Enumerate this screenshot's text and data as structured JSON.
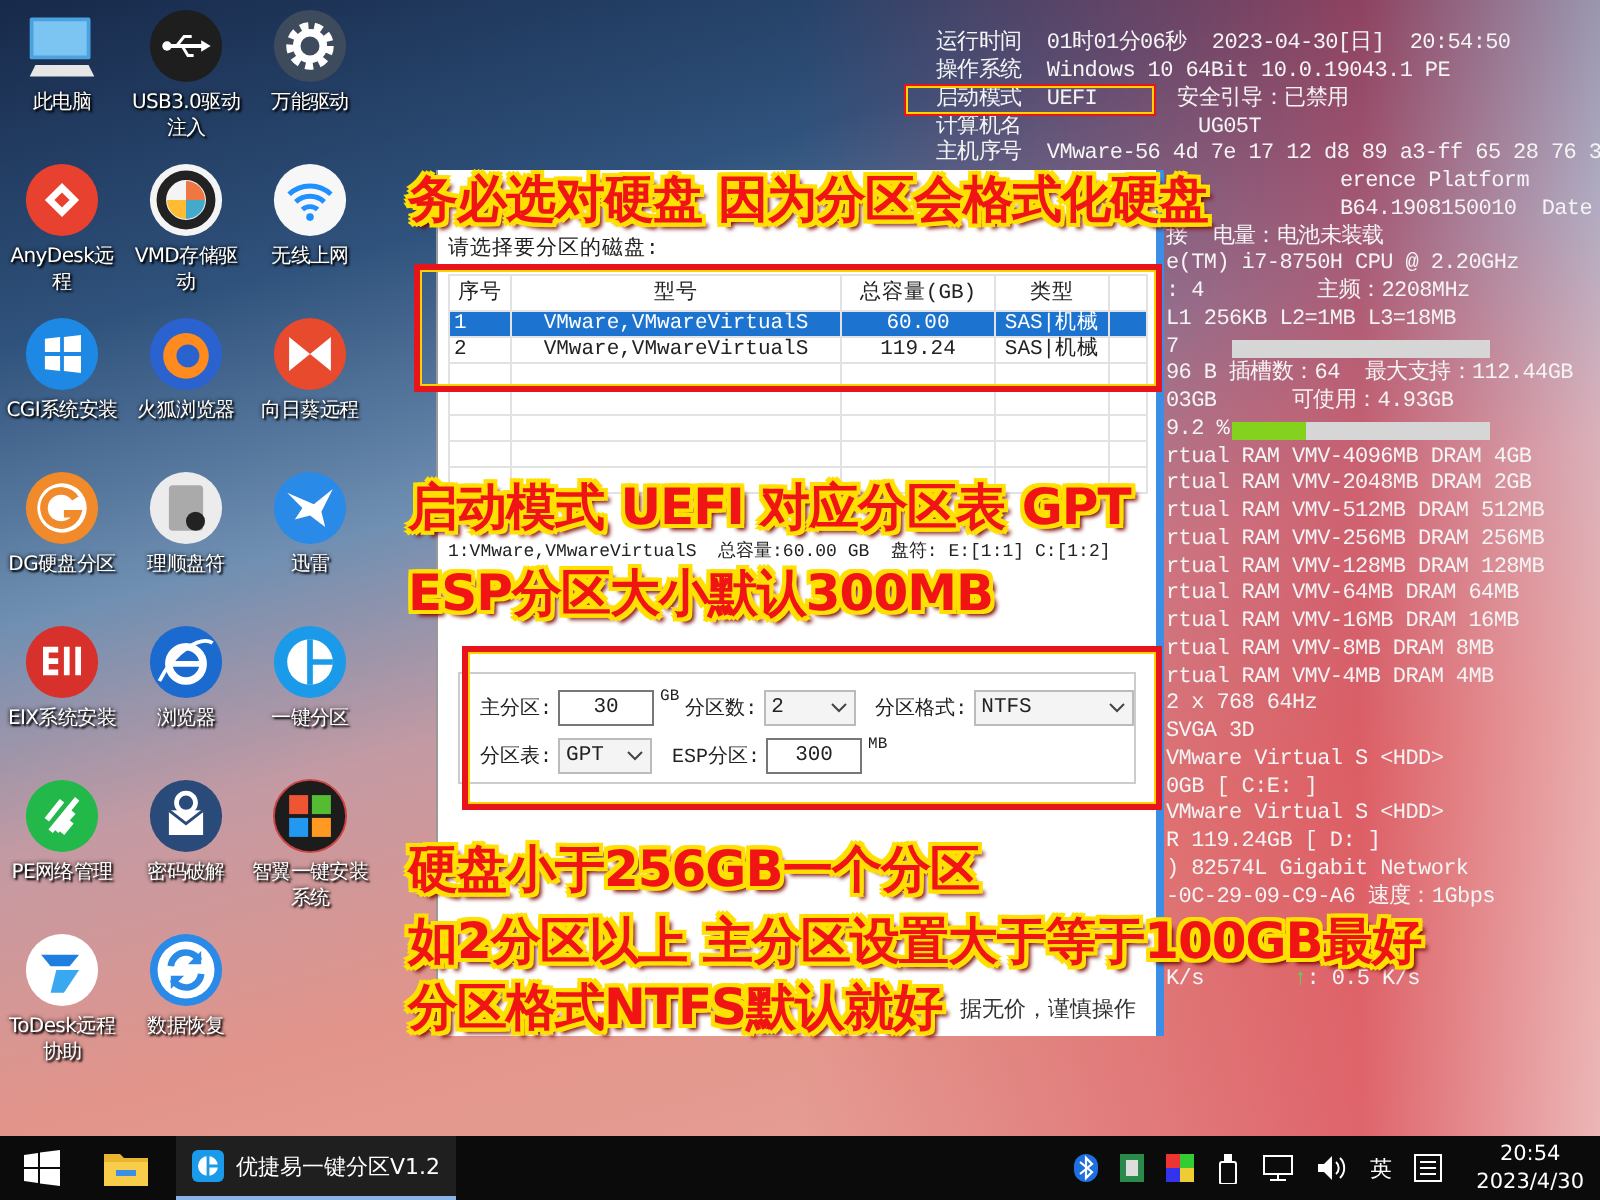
{
  "desktop_icons": [
    {
      "label": "此电脑",
      "kind": "monitor",
      "color": "#4aa3e0"
    },
    {
      "label": "USB3.0驱动注入",
      "kind": "usb",
      "color": "#1e1e1e"
    },
    {
      "label": "万能驱动",
      "kind": "gear",
      "color": "#3e4b5c"
    },
    {
      "label": "AnyDesk远程",
      "kind": "diamond",
      "color": "#e8412f"
    },
    {
      "label": "VMD存储驱动",
      "kind": "color-ring",
      "color": "#f4f4f4"
    },
    {
      "label": "无线上网",
      "kind": "wifi",
      "color": "#f7f7f7"
    },
    {
      "label": "CGI系统安装",
      "kind": "four-panes",
      "color": "#1e88e5"
    },
    {
      "label": "火狐浏览器",
      "kind": "flame",
      "color": "#2a62d0"
    },
    {
      "label": "向日葵远程",
      "kind": "bowtie",
      "color": "#e84a2e"
    },
    {
      "label": "DG硬盘分区",
      "kind": "arc",
      "color": "#f08a2a"
    },
    {
      "label": "理顺盘符",
      "kind": "disk",
      "color": "#ececec"
    },
    {
      "label": "迅雷",
      "kind": "bird",
      "color": "#2a8ae8"
    },
    {
      "label": "EIX系统安装",
      "kind": "bars",
      "color": "#d8302a"
    },
    {
      "label": "浏览器",
      "kind": "swoosh",
      "color": "#1a6ad0"
    },
    {
      "label": "一键分区",
      "kind": "pie",
      "color": "#1a9ae8"
    },
    {
      "label": "PE网络管理",
      "kind": "stripes",
      "color": "#22b84a"
    },
    {
      "label": "密码破解",
      "kind": "envelope",
      "color": "#2a4a7a"
    },
    {
      "label": "智翼一键安装系统",
      "kind": "tiles",
      "color": "#1c1c1c"
    },
    {
      "label": "ToDesk远程协助",
      "kind": "arrows",
      "color": "#ffffff"
    },
    {
      "label": "数据恢复",
      "kind": "sync",
      "color": "#2a8ae8"
    }
  ],
  "system_info": [
    {
      "kind": "full",
      "text": "运行时间  01时01分06秒  2023-04-30[日]  20:54:50"
    },
    {
      "kind": "full",
      "text": "操作系统  Windows 10 64Bit 10.0.19043.1 PE"
    },
    {
      "kind": "pair",
      "text": "启动模式  UEFI",
      "extra": "安全引导：已禁用"
    },
    {
      "kind": "full",
      "text": "计算机名              UG05T"
    },
    {
      "kind": "full",
      "text": "主机序号  VMware-56 4d 7e 17 12 d8 89 a3-ff 65 28 76 3"
    },
    {
      "kind": "far",
      "text": "erence Platform"
    },
    {
      "kind": "far",
      "text": "B64.1908150010  Date"
    },
    {
      "kind": "beside",
      "text": "接  电量：电池未装载"
    },
    {
      "kind": "beside",
      "text": "e(TM) i7-8750H CPU @ 2.20GHz"
    },
    {
      "kind": "beside",
      "text": ": 4         主频：2208MHz"
    },
    {
      "kind": "beside",
      "text": "L1 256KB L2=1MB L3=18MB"
    },
    {
      "kind": "bar",
      "text": "7",
      "level": 0
    },
    {
      "kind": "beside",
      "text": "96 B 插槽数：64  最大支持：112.44GB"
    },
    {
      "kind": "beside",
      "text": "03GB      可使用：4.93GB"
    },
    {
      "kind": "bar",
      "text": "9.2 %",
      "level": 0.29
    },
    {
      "kind": "beside",
      "text": "rtual RAM VMV-4096MB DRAM 4GB"
    },
    {
      "kind": "beside",
      "text": "rtual RAM VMV-2048MB DRAM 2GB"
    },
    {
      "kind": "beside",
      "text": "rtual RAM VMV-512MB DRAM 512MB"
    },
    {
      "kind": "beside",
      "text": "rtual RAM VMV-256MB DRAM 256MB"
    },
    {
      "kind": "beside",
      "text": "rtual RAM VMV-128MB DRAM 128MB"
    },
    {
      "kind": "beside",
      "text": "rtual RAM VMV-64MB DRAM 64MB"
    },
    {
      "kind": "beside",
      "text": "rtual RAM VMV-16MB DRAM 16MB"
    },
    {
      "kind": "beside",
      "text": "rtual RAM VMV-8MB DRAM 8MB"
    },
    {
      "kind": "beside",
      "text": "rtual RAM VMV-4MB DRAM 4MB"
    },
    {
      "kind": "beside",
      "text": "2 x 768 64Hz"
    },
    {
      "kind": "beside",
      "text": "SVGA 3D"
    },
    {
      "kind": "beside",
      "text": "VMware Virtual S <HDD>"
    },
    {
      "kind": "beside",
      "text": "0GB [ C:E: ]"
    },
    {
      "kind": "beside",
      "text": "VMware Virtual S <HDD>"
    },
    {
      "kind": "beside",
      "text": "R 119.24GB [ D: ]"
    },
    {
      "kind": "beside",
      "text": ") 82574L Gigabit Network"
    },
    {
      "kind": "beside",
      "text": "-0C-29-09-C9-A6 速度：1Gbps"
    },
    {
      "kind": "speed",
      "text": "K/s",
      "arrow": "↑",
      "rate": ": 0.5 K/s"
    }
  ],
  "dialog": {
    "prompt": "请选择要分区的磁盘:",
    "columns": [
      "序号",
      "型号",
      "总容量(GB)",
      "类型"
    ],
    "rows": [
      {
        "cells": [
          "1",
          "VMware,VMwareVirtualS",
          "60.00",
          "SAS|机械"
        ],
        "selected": true
      },
      {
        "cells": [
          "2",
          "VMware,VMwareVirtualS",
          "119.24",
          "SAS|机械"
        ],
        "selected": false
      }
    ],
    "summary": "1:VMware,VMwareVirtualS  总容量:60.00 GB  盘符: E:[1:1] C:[1:2]",
    "settings": [
      [
        {
          "kind": "input",
          "label": "主分区:",
          "value": "30",
          "unit": "GB"
        },
        {
          "kind": "select",
          "label": "分区数:",
          "value": "2"
        },
        {
          "kind": "select",
          "label": "分区格式:",
          "value": "NTFS"
        }
      ],
      [
        {
          "kind": "select",
          "label": "分区表:",
          "value": "GPT"
        },
        {
          "kind": "input",
          "label": "ESP分区:",
          "value": "300",
          "unit": "MB"
        }
      ]
    ],
    "footer": "据无价，谨慎操作"
  },
  "annotations": [
    "务必选对硬盘 因为分区会格式化硬盘",
    "启动模式 UEFI 对应分区表 GPT",
    "ESP分区大小默认300MB",
    "硬盘小于256GB一个分区",
    "如2分区以上 主分区设置大于等于100GB最好",
    "分区格式NTFS默认就好"
  ],
  "taskbar": {
    "app": {
      "label": "优捷易一键分区V1.2",
      "active": true
    },
    "ime": "英",
    "time": "20:54",
    "date": "2023/4/30"
  }
}
